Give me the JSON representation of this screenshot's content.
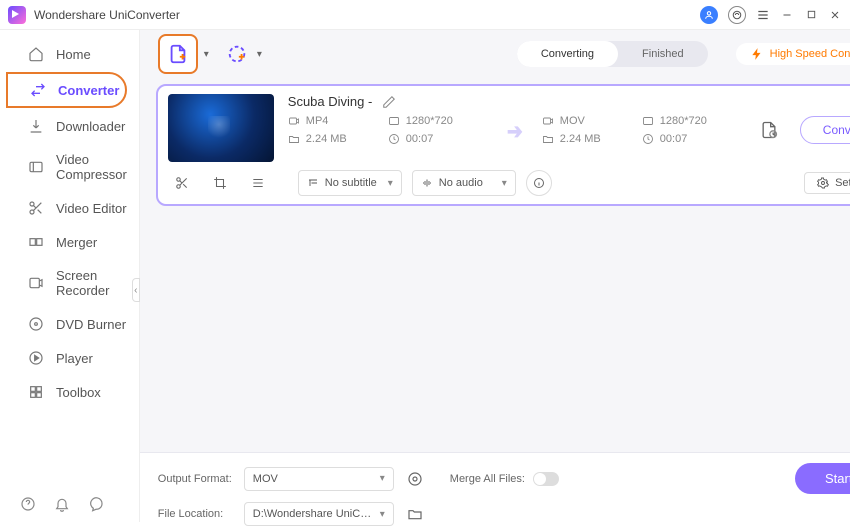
{
  "app": {
    "title": "Wondershare UniConverter"
  },
  "sidebar": {
    "items": [
      {
        "label": "Home"
      },
      {
        "label": "Converter"
      },
      {
        "label": "Downloader"
      },
      {
        "label": "Video Compressor"
      },
      {
        "label": "Video Editor"
      },
      {
        "label": "Merger"
      },
      {
        "label": "Screen Recorder"
      },
      {
        "label": "DVD Burner"
      },
      {
        "label": "Player"
      },
      {
        "label": "Toolbox"
      }
    ]
  },
  "toolbar": {
    "tabs": {
      "converting": "Converting",
      "finished": "Finished"
    },
    "hsc": "High Speed Conversion"
  },
  "item": {
    "name": "Scuba Diving -",
    "src": {
      "format": "MP4",
      "resolution": "1280*720",
      "size": "2.24 MB",
      "duration": "00:07"
    },
    "dst": {
      "format": "MOV",
      "resolution": "1280*720",
      "size": "2.24 MB",
      "duration": "00:07"
    },
    "subtitle": "No subtitle",
    "audio": "No audio",
    "settings": "Settings",
    "convert": "Convert"
  },
  "footer": {
    "output_format_label": "Output Format:",
    "output_format_value": "MOV",
    "file_location_label": "File Location:",
    "file_location_value": "D:\\Wondershare UniConverter",
    "merge_label": "Merge All Files:",
    "start_all": "Start All"
  }
}
